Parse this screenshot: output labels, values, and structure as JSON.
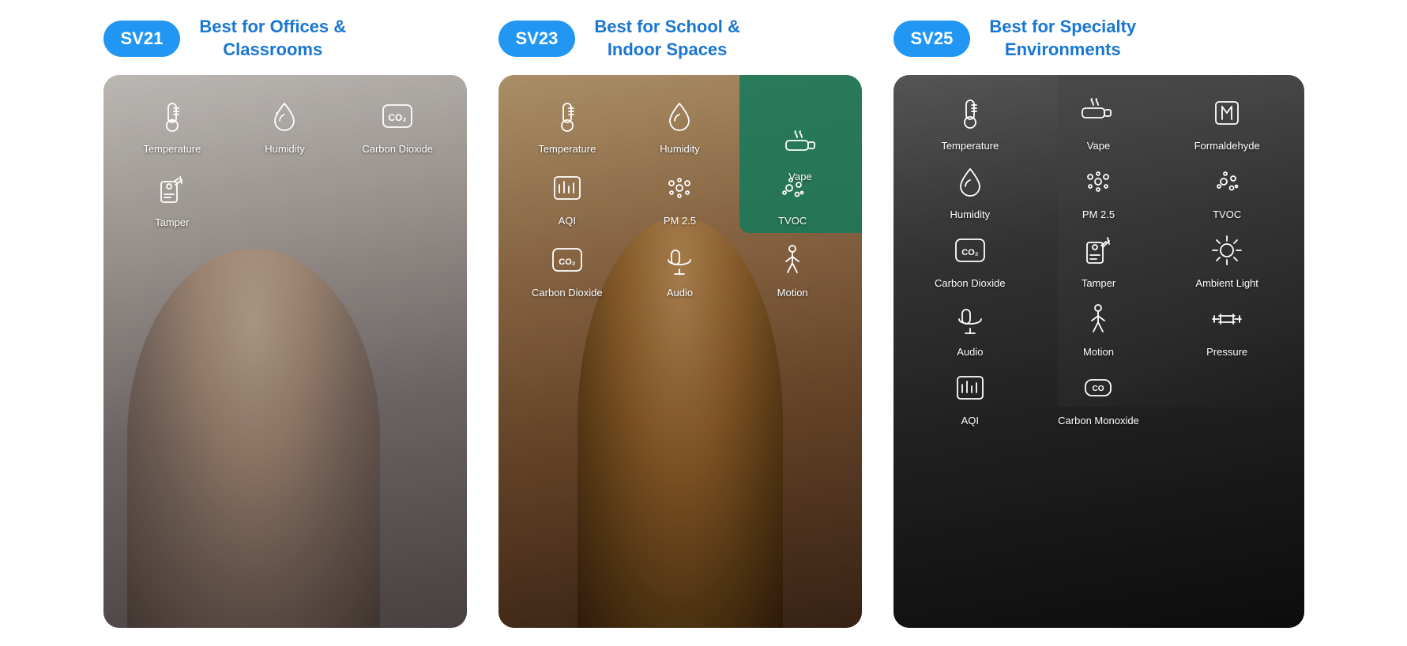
{
  "products": [
    {
      "id": "sv21",
      "badge": "SV21",
      "title": "Best for Offices & Classrooms",
      "bg_class": "card-bg-sv21",
      "photo_class": "photo-sv21",
      "sensors_grid_class": "sensors-grid-sv21",
      "sensors": [
        {
          "label": "Temperature",
          "icon": "thermometer"
        },
        {
          "label": "Humidity",
          "icon": "humidity"
        },
        {
          "label": "Carbon Dioxide",
          "icon": "co2"
        },
        {
          "label": "Tamper",
          "icon": "tamper",
          "wide": true
        }
      ]
    },
    {
      "id": "sv23",
      "badge": "SV23",
      "title": "Best for School & Indoor Spaces",
      "bg_class": "card-bg-sv23",
      "photo_class": "photo-sv23",
      "sensors_grid_class": "sensors-grid-sv23",
      "sensors": [
        {
          "label": "Temperature",
          "icon": "thermometer"
        },
        {
          "label": "Humidity",
          "icon": "humidity"
        },
        {
          "label": "Vape",
          "icon": "vape",
          "highlighted": true
        },
        {
          "label": "AQI",
          "icon": "aqi"
        },
        {
          "label": "PM 2.5",
          "icon": "pm25"
        },
        {
          "label": "TVOC",
          "icon": "tvoc"
        },
        {
          "label": "Carbon Dioxide",
          "icon": "co2"
        },
        {
          "label": "Audio",
          "icon": "audio"
        },
        {
          "label": "Motion",
          "icon": "motion"
        }
      ]
    },
    {
      "id": "sv25",
      "badge": "SV25",
      "title": "Best for Specialty Environments",
      "bg_class": "card-bg-sv25",
      "photo_class": "photo-sv25",
      "sensors_grid_class": "sensors-grid-sv25",
      "sensors": [
        {
          "label": "Temperature",
          "icon": "thermometer"
        },
        {
          "label": "Vape",
          "icon": "vape"
        },
        {
          "label": "Formaldehyde",
          "icon": "formaldehyde"
        },
        {
          "label": "Humidity",
          "icon": "humidity"
        },
        {
          "label": "PM 2.5",
          "icon": "pm25"
        },
        {
          "label": "TVOC",
          "icon": "tvoc"
        },
        {
          "label": "Carbon Dioxide",
          "icon": "co2"
        },
        {
          "label": "Tamper",
          "icon": "tamper"
        },
        {
          "label": "Ambient Light",
          "icon": "light"
        },
        {
          "label": "Audio",
          "icon": "audio"
        },
        {
          "label": "Motion",
          "icon": "motion"
        },
        {
          "label": "Pressure",
          "icon": "pressure"
        },
        {
          "label": "AQI",
          "icon": "aqi"
        },
        {
          "label": "Carbon Monoxide",
          "icon": "carbon_monoxide"
        }
      ]
    }
  ]
}
